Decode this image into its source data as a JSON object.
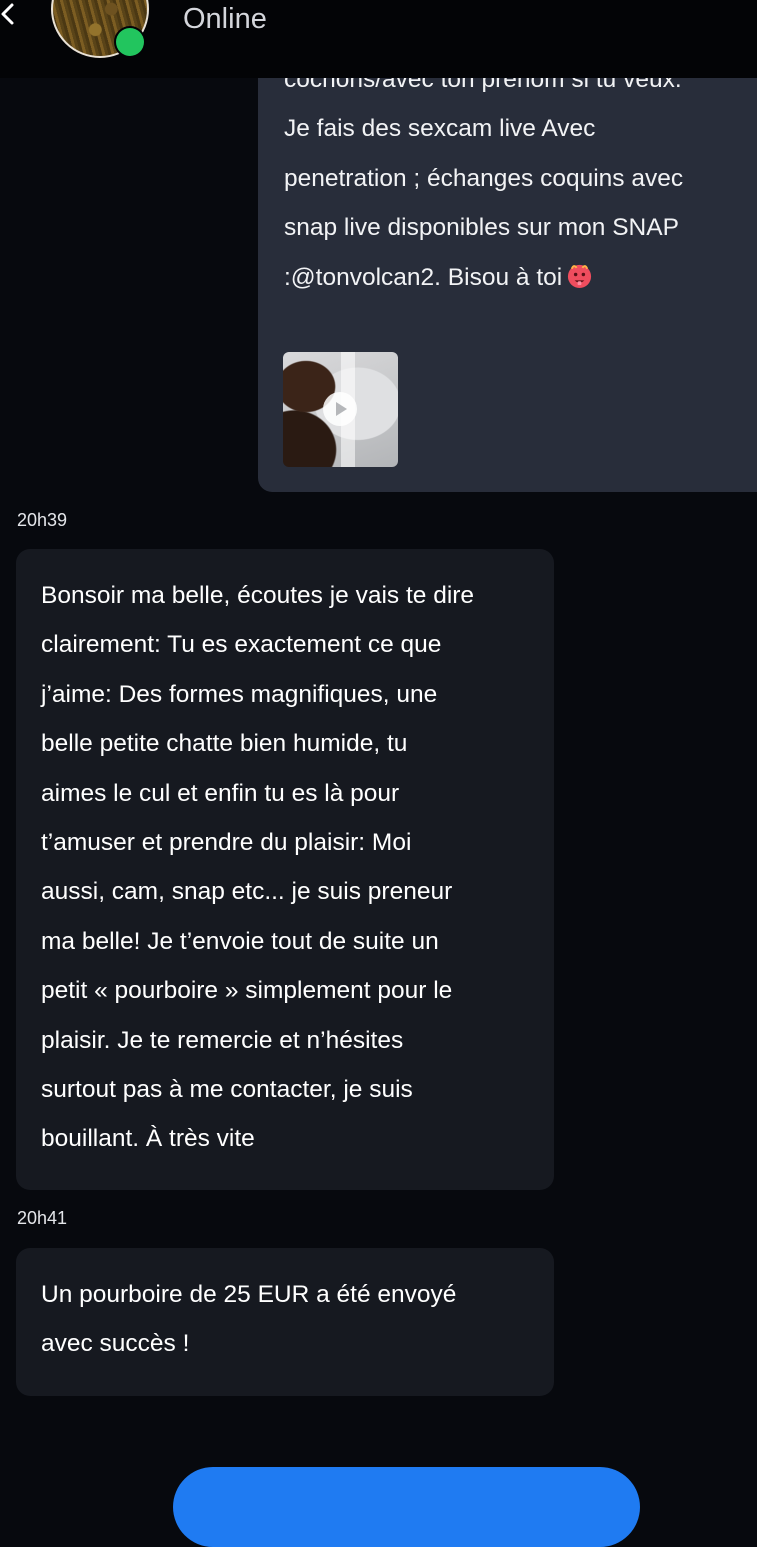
{
  "header": {
    "status": "Online",
    "icons": {
      "back": "chevron-left-icon",
      "online_indicator": "online-dot"
    }
  },
  "messages": {
    "outgoing": {
      "text": "cochons/avec ton prénom si tu veux.\nJe fais des sexcam live Avec\npenetration ; échanges coquins avec\nsnap live disponibles sur mon SNAP\n:@tonvolcan2. Bisou à toi",
      "emoji": "hot-face-emoji",
      "attachment": {
        "type": "video",
        "icon": "play-icon"
      }
    },
    "time_1": "20h39",
    "incoming_1": "Bonsoir ma belle, écoutes je vais te dire\nclairement: Tu es exactement ce que\nj’aime: Des formes magnifiques, une\nbelle petite chatte bien humide, tu\naimes le cul et enfin tu es là pour\nt’amuser et prendre du plaisir: Moi\naussi, cam, snap etc... je suis preneur\nma belle! Je t’envoie tout de suite un\npetit « pourboire » simplement pour le\nplaisir. Je te remercie et n’hésites\nsurtout pas à me contacter, je suis\nbouillant. À très vite",
    "time_2": "20h41",
    "incoming_2": "Un pourboire de 25 EUR a été envoyé\navec succès !"
  },
  "cta": {
    "label": ""
  },
  "colors": {
    "background": "#07090e",
    "outgoing_bubble": "#282d3a",
    "incoming_bubble": "#161920",
    "online": "#22c55e",
    "cta": "#1f7bf2"
  }
}
